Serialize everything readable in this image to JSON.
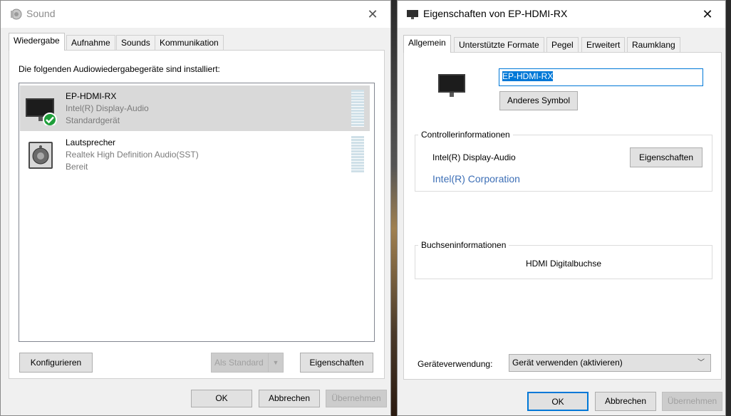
{
  "sound": {
    "title": "Sound",
    "tabs": [
      {
        "label": "Wiedergabe",
        "active": true
      },
      {
        "label": "Aufnahme"
      },
      {
        "label": "Sounds"
      },
      {
        "label": "Kommunikation"
      }
    ],
    "instructions": "Die folgenden Audiowiedergabegeräte sind installiert:",
    "devices": [
      {
        "name": "EP-HDMI-RX",
        "driver": "Intel(R) Display-Audio",
        "status": "Standardgerät",
        "icon": "monitor-icon",
        "selected": true
      },
      {
        "name": "Lautsprecher",
        "driver": "Realtek High Definition Audio(SST)",
        "status": "Bereit",
        "icon": "speaker-icon",
        "selected": false
      }
    ],
    "buttons": {
      "configure": "Konfigurieren",
      "set_default": "Als Standard",
      "properties": "Eigenschaften",
      "ok": "OK",
      "cancel": "Abbrechen",
      "apply": "Übernehmen"
    }
  },
  "props": {
    "title": "Eigenschaften von EP-HDMI-RX",
    "tabs": [
      {
        "label": "Allgemein",
        "active": true
      },
      {
        "label": "Unterstützte Formate"
      },
      {
        "label": "Pegel"
      },
      {
        "label": "Erweitert"
      },
      {
        "label": "Raumklang"
      }
    ],
    "device_name_value": "EP-HDMI-RX",
    "change_icon_button": "Anderes Symbol",
    "controller": {
      "label": "Controllerinformationen",
      "name": "Intel(R) Display-Audio",
      "properties_button": "Eigenschaften",
      "manufacturer": "Intel(R) Corporation"
    },
    "jack": {
      "label": "Buchseninformationen",
      "value": "HDMI Digitalbuchse"
    },
    "usage": {
      "label": "Geräteverwendung:",
      "value": "Gerät verwenden (aktivieren)"
    },
    "buttons": {
      "ok": "OK",
      "cancel": "Abbrechen",
      "apply": "Übernehmen"
    }
  },
  "colors": {
    "accent": "#0078d7",
    "selection": "#0078d7",
    "link": "#3d6fb6",
    "check": "#1e9e3a"
  }
}
